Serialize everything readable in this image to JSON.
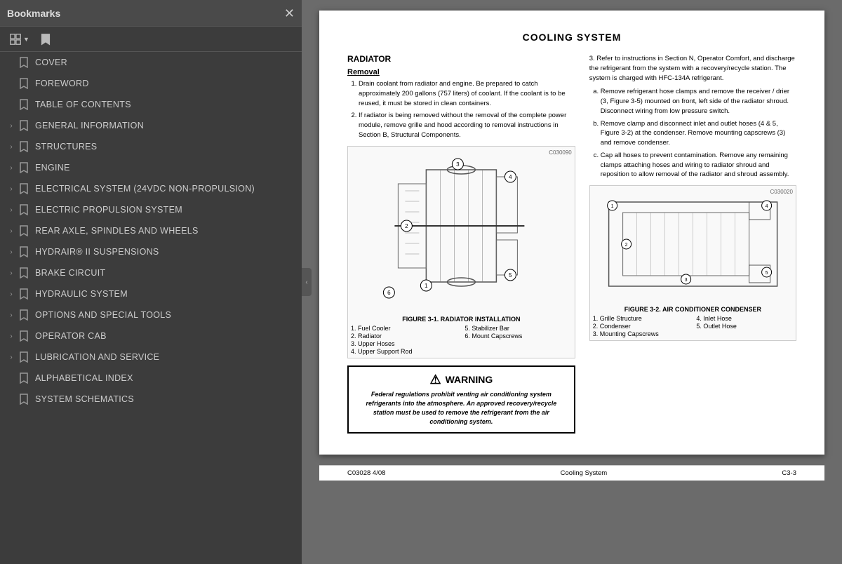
{
  "sidebar": {
    "title": "Bookmarks",
    "items": [
      {
        "id": "cover",
        "label": "COVER",
        "hasChevron": false,
        "level": 0
      },
      {
        "id": "foreword",
        "label": "FOREWORD",
        "hasChevron": false,
        "level": 0
      },
      {
        "id": "toc",
        "label": "TABLE OF CONTENTS",
        "hasChevron": false,
        "level": 0
      },
      {
        "id": "general-info",
        "label": "GENERAL INFORMATION",
        "hasChevron": true,
        "level": 0
      },
      {
        "id": "structures",
        "label": "STRUCTURES",
        "hasChevron": true,
        "level": 0
      },
      {
        "id": "engine",
        "label": "ENGINE",
        "hasChevron": true,
        "level": 0
      },
      {
        "id": "electrical",
        "label": "ELECTRICAL SYSTEM (24VDC NON-PROPULSION)",
        "hasChevron": true,
        "level": 0
      },
      {
        "id": "electric-propulsion",
        "label": "ELECTRIC PROPULSION SYSTEM",
        "hasChevron": true,
        "level": 0
      },
      {
        "id": "rear-axle",
        "label": "REAR AXLE, SPINDLES AND WHEELS",
        "hasChevron": true,
        "level": 0
      },
      {
        "id": "hydrair",
        "label": "HYDRAIR® II SUSPENSIONS",
        "hasChevron": true,
        "level": 0
      },
      {
        "id": "brake",
        "label": "BRAKE CIRCUIT",
        "hasChevron": true,
        "level": 0
      },
      {
        "id": "hydraulic",
        "label": "HYDRAULIC SYSTEM",
        "hasChevron": true,
        "level": 0
      },
      {
        "id": "options",
        "label": "OPTIONS AND SPECIAL TOOLS",
        "hasChevron": true,
        "level": 0
      },
      {
        "id": "operator-cab",
        "label": "OPERATOR CAB",
        "hasChevron": true,
        "level": 0
      },
      {
        "id": "lubrication",
        "label": "LUBRICATION AND SERVICE",
        "hasChevron": true,
        "level": 0
      },
      {
        "id": "alphabetical",
        "label": "ALPHABETICAL INDEX",
        "hasChevron": false,
        "level": 0
      },
      {
        "id": "schematics",
        "label": "SYSTEM SCHEMATICS",
        "hasChevron": false,
        "level": 0
      }
    ]
  },
  "document": {
    "title": "COOLING SYSTEM",
    "sections": {
      "radiator": {
        "title": "RADIATOR",
        "subsection": "Removal",
        "steps": [
          "Drain coolant from radiator and engine. Be prepared to catch approximately 200 gallons (757 liters) of coolant. If the coolant is to be reused, it must be stored in clean containers.",
          "If radiator is being removed without the removal of the complete power module, remove grille and hood according to removal instructions in Section B, Structural Components."
        ]
      },
      "right_col": {
        "step3": "3. Refer to instructions in Section N, Operator Comfort, and discharge the refrigerant from the system with a recovery/recycle station. The system is charged with HFC-134A refrigerant.",
        "alpha_items": [
          "Remove refrigerant hose clamps and remove the receiver / drier (3, Figure 3-5) mounted on front, left side of the radiator shroud. Disconnect wiring from low pressure switch.",
          "Remove clamp and disconnect inlet and outlet hoses (4 & 5, Figure 3-2) at the condenser. Remove mounting capscrews (3) and remove condenser.",
          "Cap all hoses to prevent contamination. Remove any remaining clamps attaching hoses and wiring to radiator shroud and reposition to allow removal of the radiator and shroud assembly."
        ]
      }
    },
    "figure1": {
      "code": "C030090",
      "caption": "FIGURE 3-1. RADIATOR INSTALLATION",
      "legend": [
        "1. Fuel Cooler",
        "5. Stabilizer Bar",
        "2. Radiator",
        "6. Mount Capscrews",
        "3. Upper Hoses",
        "",
        "4. Upper Support Rod",
        ""
      ]
    },
    "figure2": {
      "code": "C030020",
      "caption": "FIGURE 3-2. AIR CONDITIONER CONDENSER",
      "legend": [
        "1. Grille Structure",
        "4. Inlet Hose",
        "2. Condenser",
        "5. Outlet Hose",
        "3. Mounting Capscrews",
        ""
      ]
    },
    "warning": {
      "title": "WARNING",
      "text": "Federal regulations prohibit venting air conditioning system refrigerants into the atmosphere. An approved recovery/recycle station must be used to remove the refrigerant from the air conditioning system."
    },
    "footer": {
      "left": "C03028  4/08",
      "center": "Cooling System",
      "right": "C3-3"
    }
  },
  "icons": {
    "close": "✕",
    "chevron_right": "›",
    "bookmark_empty": "⌞",
    "collapse": "‹"
  }
}
